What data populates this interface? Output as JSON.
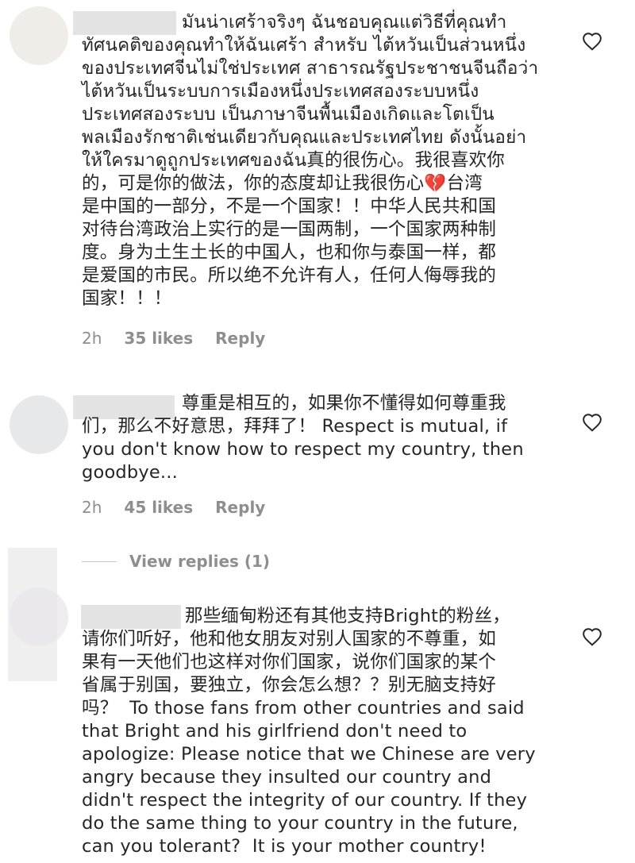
{
  "comments": [
    {
      "text": "มันน่าเศร้าจริงๆ ฉันชอบคุณแต่วิธีที่คุณทำ\nทัศนคติของคุณทำให้ฉันเศร้า สำหรับ ไต้หวันเป็นส่วนหนึ่ง\nของประเทศจีนไม่ใช่ประเทศ สาธารณรัฐประชาชนจีนถือว่า\nไต้หวันเป็นระบบการเมืองหนึ่งประเทศสองระบบหนึ่ง\nประเทศสองระบบ เป็นภาษาจีนพื้นเมืองเกิดและโตเป็น\nพลเมืองรักชาติเช่นเดียวกับคุณและประเทศไทย ดังนั้นอย่า\nให้ใครมาดูถูกประเทศของฉัน真的很伤心。我很喜欢你\n的，可是你的做法，你的态度却让我很伤心💔台湾\n是中国的一部分，不是一个国家！！中华人民共和国\n对待台湾政治上实行的是一国两制，一个国家两种制\n度。身为土生土长的中国人，也和你与泰国一样，都\n是爱国的市民。所以绝不允许有人，任何人侮辱我的\n国家！！！",
      "time": "2h",
      "likes": "35 likes",
      "reply": "Reply"
    },
    {
      "text": "尊重是相互的，如果你不懂得如何尊重我\n们，那么不好意思，拜拜了！ Respect is mutual, if\nyou don't know how to respect my country, then\ngoodbye...",
      "time": "2h",
      "likes": "45 likes",
      "reply": "Reply"
    },
    {
      "text": "那些缅甸粉还有其他支持Bright的粉丝，\n请你们听好，他和他女朋友对别人国家的不尊重，如\n果有一天他们也这样对你们国家，说你们国家的某个\n省属于别国，要独立，你会怎么想？？别无脑支持好\n吗？  To those fans from other countries and said\nthat Bright and his girlfriend don't need to\napologize: Please notice that we Chinese are very\nangry because they insulted our country and\ndidn't respect the integrity of our country. If they\ndo the same thing to your country in the future,\ncan you tolerant?  It is your mother country!"
    }
  ],
  "view_replies": "View replies (1)",
  "colors": {
    "text": "#262626",
    "meta": "#8e8e8e",
    "blur": "#e3e3e3"
  },
  "icons": [
    "heart-icon",
    "avatar"
  ]
}
